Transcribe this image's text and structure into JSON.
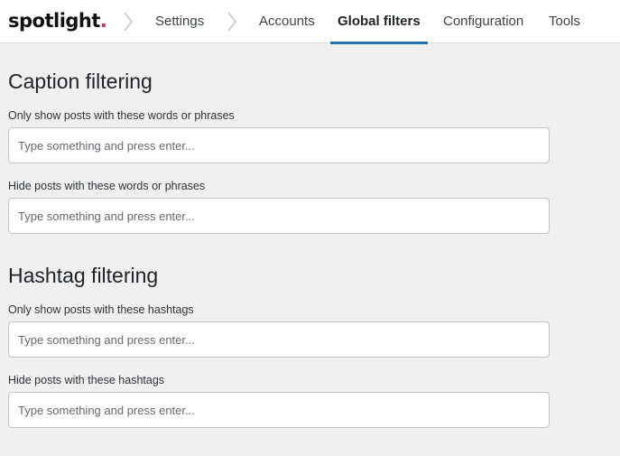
{
  "app": {
    "logo_text": "spotlight",
    "logo_dot": ".",
    "accent_color": "#2271b1",
    "logo_dot_color": "#e8234f"
  },
  "breadcrumb": {
    "settings": "Settings"
  },
  "tabs": [
    {
      "label": "Accounts",
      "active": false
    },
    {
      "label": "Global filters",
      "active": true
    },
    {
      "label": "Configuration",
      "active": false
    },
    {
      "label": "Tools",
      "active": false
    }
  ],
  "caption": {
    "title": "Caption filtering",
    "include_label": "Only show posts with these words or phrases",
    "include_placeholder": "Type something and press enter...",
    "include_value": "",
    "exclude_label": "Hide posts with these words or phrases",
    "exclude_placeholder": "Type something and press enter...",
    "exclude_value": ""
  },
  "hashtag": {
    "title": "Hashtag filtering",
    "include_label": "Only show posts with these hashtags",
    "include_placeholder": "Type something and press enter...",
    "include_value": "",
    "exclude_label": "Hide posts with these hashtags",
    "exclude_placeholder": "Type something and press enter...",
    "exclude_value": ""
  }
}
